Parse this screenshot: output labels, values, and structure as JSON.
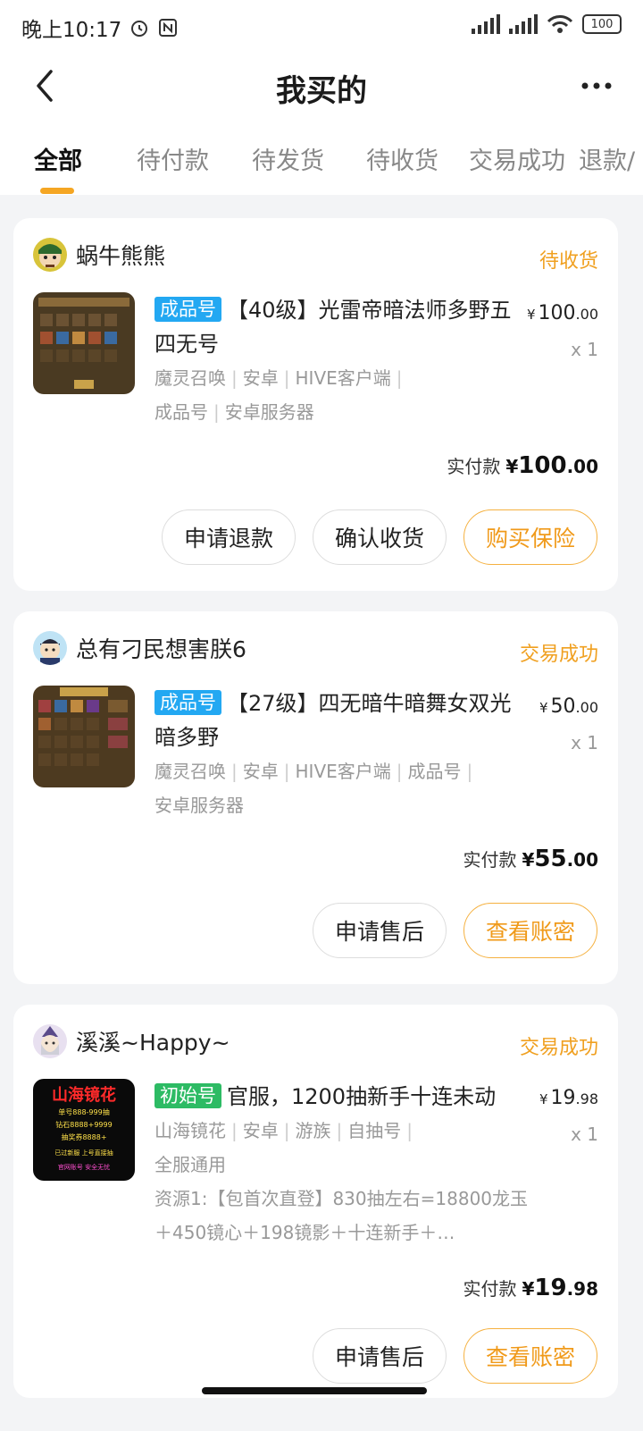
{
  "status_bar": {
    "time": "晚上10:17",
    "battery": "100",
    "network": "HD"
  },
  "header": {
    "title": "我买的"
  },
  "tabs": [
    {
      "label": "全部"
    },
    {
      "label": "待付款"
    },
    {
      "label": "待发货"
    },
    {
      "label": "待收货"
    },
    {
      "label": "交易成功"
    },
    {
      "label": "退款/"
    }
  ],
  "orders": [
    {
      "seller": "蜗牛熊熊",
      "status": "待收货",
      "badge": "成品号",
      "title": "【40级】光雷帝暗法师多野五四无号",
      "tags": [
        "魔灵召唤",
        "安卓",
        "HIVE客户端",
        "成品号",
        "安卓服务器"
      ],
      "price_int": "100",
      "price_dec": ".00",
      "qty": "x 1",
      "paid_label": "实付款",
      "paid_int": "100",
      "paid_dec": ".00",
      "buttons": [
        "申请退款",
        "确认收货",
        "购买保险"
      ]
    },
    {
      "seller": "总有刁民想害朕6",
      "status": "交易成功",
      "badge": "成品号",
      "title": "【27级】四无暗牛暗舞女双光暗多野",
      "tags": [
        "魔灵召唤",
        "安卓",
        "HIVE客户端",
        "成品号",
        "安卓服务器"
      ],
      "price_int": "50",
      "price_dec": ".00",
      "qty": "x 1",
      "paid_label": "实付款",
      "paid_int": "55",
      "paid_dec": ".00",
      "buttons": [
        "申请售后",
        "查看账密"
      ]
    },
    {
      "seller": "溪溪~Happy~",
      "status": "交易成功",
      "badge": "初始号",
      "title": "官服，1200抽新手十连未动",
      "tags": [
        "山海镜花",
        "安卓",
        "游族",
        "自抽号",
        "全服通用"
      ],
      "desc": "资源1:【包首次直登】830抽左右=18800龙玉＋450镜心＋198镜影＋十连新手＋…",
      "price_int": "19",
      "price_dec": ".98",
      "qty": "x 1",
      "paid_label": "实付款",
      "paid_int": "19",
      "paid_dec": ".98",
      "buttons": [
        "申请售后",
        "查看账密"
      ],
      "thumb_text": [
        "山海镜花",
        "单号888-999抽",
        "钻石8888+9999",
        "抽奖券8888+",
        "已过新服 上号直接抽",
        "官网账号 安全无忧"
      ]
    }
  ],
  "currency": "¥",
  "colors": {
    "accent": "#f5a623",
    "status": "#f0a020",
    "badge_blue": "#23a8f2",
    "badge_green": "#2dbb64"
  }
}
